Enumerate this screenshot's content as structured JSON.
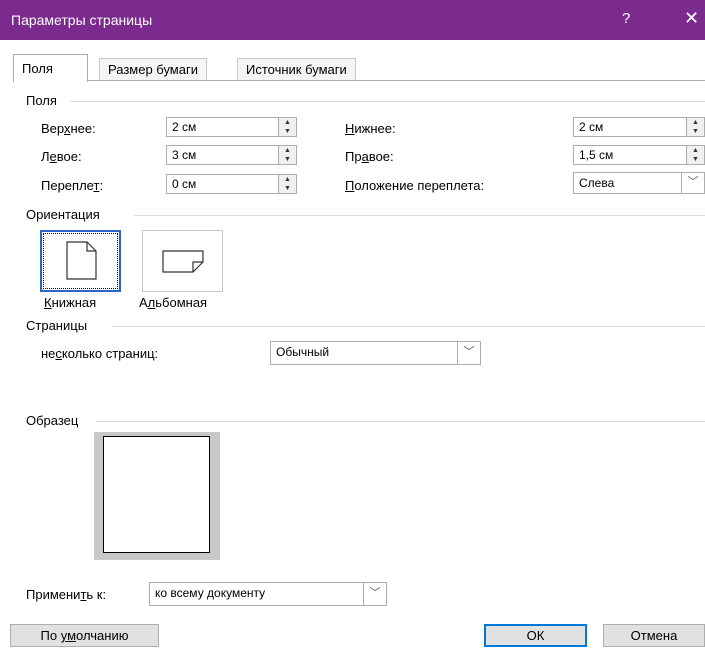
{
  "window": {
    "title": "Параметры страницы",
    "help": "?",
    "close": "✕"
  },
  "tabs": [
    "Поля",
    "Размер бумаги",
    "Источник бумаги"
  ],
  "margins": {
    "group": "Поля",
    "top": {
      "label_pre": "Вер",
      "label_u": "х",
      "label_post": "нее:",
      "value": "2 см"
    },
    "left": {
      "label_pre": "Л",
      "label_u": "е",
      "label_post": "вое:",
      "value": "3 см"
    },
    "gutter": {
      "label_pre": "Перепле",
      "label_u": "т",
      "label_post": ":",
      "value": "0 см"
    },
    "bottom": {
      "label_pre": "",
      "label_u": "Н",
      "label_post": "ижнее:",
      "value": "2 см"
    },
    "right": {
      "label_pre": "Пр",
      "label_u": "а",
      "label_post": "вое:",
      "value": "1,5 см"
    },
    "gutter_pos": {
      "label_pre": "",
      "label_u": "П",
      "label_post": "оложение переплета:",
      "value": "Слева"
    }
  },
  "orientation": {
    "group": "Ориентация",
    "portrait": {
      "label_u": "К",
      "label_post": "нижная"
    },
    "landscape": {
      "label_pre": "А",
      "label_u": "л",
      "label_post": "ьбомная"
    }
  },
  "pages": {
    "group": "Страницы",
    "multi_pre": "не",
    "multi_u": "с",
    "multi_post": "колько страниц:",
    "value": "Обычный"
  },
  "preview": {
    "group": "Образец"
  },
  "apply": {
    "label_pre": "Примени",
    "label_u": "т",
    "label_post": "ь к:",
    "value": "ко всему документу"
  },
  "buttons": {
    "default_pre": "По ",
    "default_u": "ум",
    "default_post": "олчанию",
    "ok": "ОК",
    "cancel": "Отмена"
  }
}
